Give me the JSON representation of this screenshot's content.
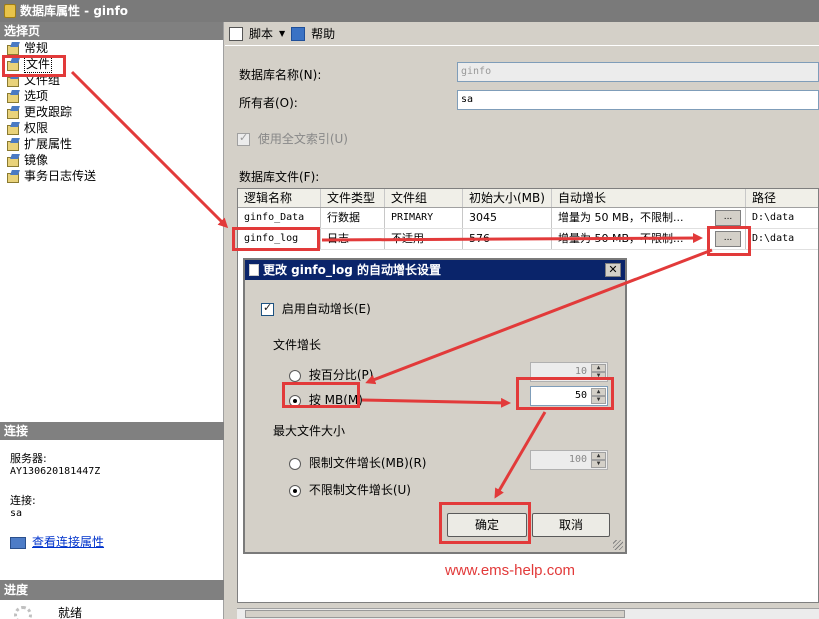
{
  "window": {
    "title": "数据库属性 - ginfo"
  },
  "left_panel": {
    "header": "选择页",
    "items": [
      {
        "label": "常规"
      },
      {
        "label": "文件"
      },
      {
        "label": "文件组"
      },
      {
        "label": "选项"
      },
      {
        "label": "更改跟踪"
      },
      {
        "label": "权限"
      },
      {
        "label": "扩展属性"
      },
      {
        "label": "镜像"
      },
      {
        "label": "事务日志传送"
      }
    ],
    "connection": {
      "header": "连接",
      "server_label": "服务器:",
      "server_value": "AY130620181447Z",
      "connection_label": "连接:",
      "connection_value": "sa",
      "view_link": "查看连接属性"
    },
    "progress": {
      "header": "进度",
      "status": "就绪"
    }
  },
  "toolbar": {
    "script_label": "脚本",
    "help_label": "帮助"
  },
  "form": {
    "db_name_label": "数据库名称(N):",
    "db_name_value": "ginfo",
    "owner_label": "所有者(O):",
    "owner_value": "sa",
    "fulltext_label": "使用全文索引(U)",
    "files_label": "数据库文件(F):"
  },
  "files_table": {
    "columns": [
      "逻辑名称",
      "文件类型",
      "文件组",
      "初始大小(MB)",
      "自动增长",
      "路径"
    ],
    "rows": [
      [
        "ginfo_Data",
        "行数据",
        "PRIMARY",
        "3045",
        "增量为 50 MB，不限制...",
        "D:\\data"
      ],
      [
        "ginfo_log",
        "日志",
        "不适用",
        "576",
        "增量为 50 MB，不限制...",
        "D:\\data"
      ]
    ],
    "ellipsis": "..."
  },
  "dialog": {
    "title": "更改 ginfo_log 的自动增长设置",
    "close": "✕",
    "enable_autogrowth": "启用自动增长(E)",
    "file_growth_label": "文件增长",
    "by_percent_label": "按百分比(P)",
    "by_percent_value": "10",
    "by_mb_label": "按 MB(M)",
    "by_mb_value": "50",
    "max_size_label": "最大文件大小",
    "limit_label": "限制文件增长(MB)(R)",
    "limit_value": "100",
    "unlimited_label": "不限制文件增长(U)",
    "ok_label": "确定",
    "cancel_label": "取消"
  },
  "watermark": "www.ems-help.com",
  "colors": {
    "annotation_red": "#e23a3a",
    "title_bar": "#0a246a"
  }
}
